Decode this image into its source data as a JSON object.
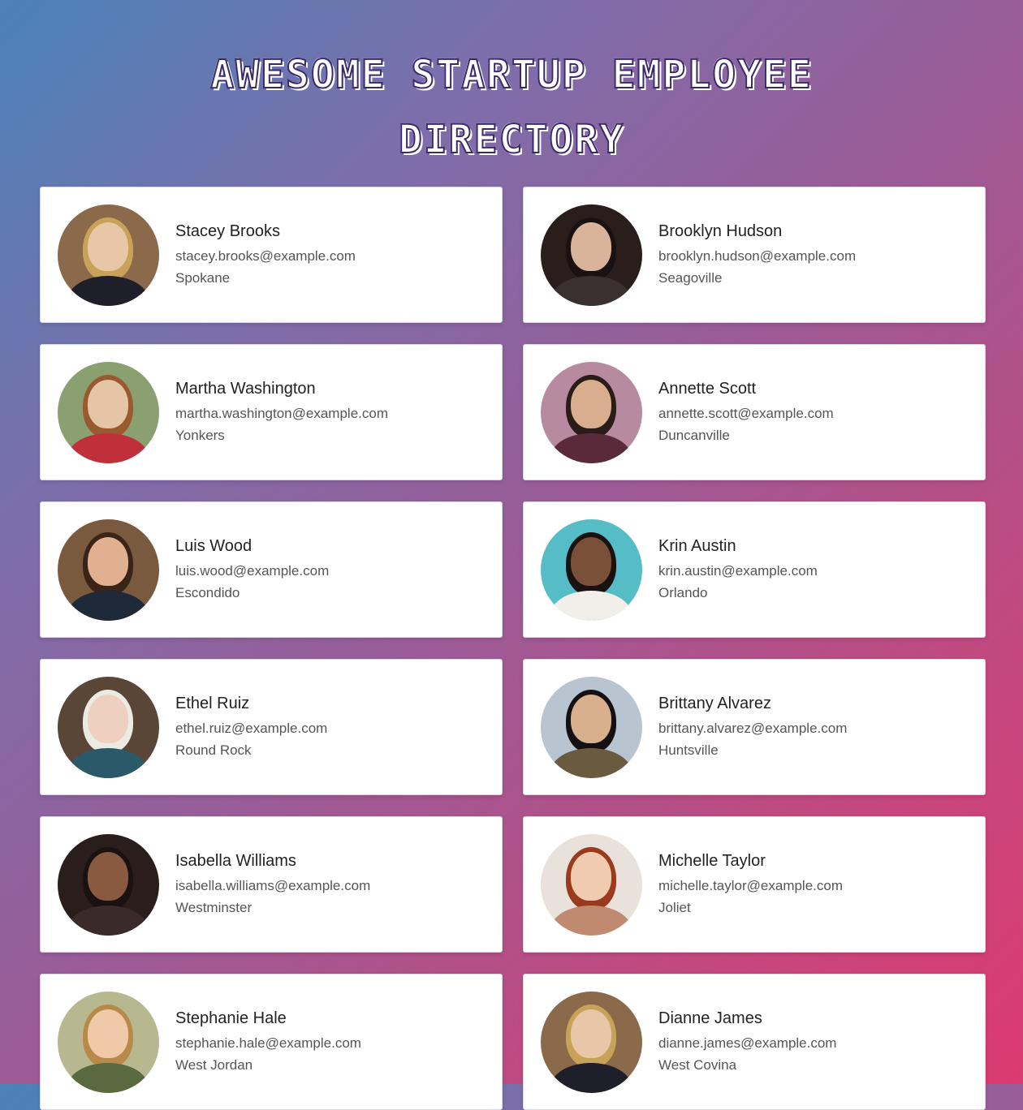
{
  "page": {
    "title": "Awesome Startup Employee Directory"
  },
  "employees": [
    {
      "name": "Stacey Brooks",
      "email": "stacey.brooks@example.com",
      "city": "Spokane",
      "avatar": {
        "bg": "#8a6a4a",
        "skin": "#e8c6a8",
        "hair": "#c9a25a",
        "clothes": "#1f1f2a"
      }
    },
    {
      "name": "Brooklyn Hudson",
      "email": "brooklyn.hudson@example.com",
      "city": "Seagoville",
      "avatar": {
        "bg": "#2a1e1c",
        "skin": "#d9b49a",
        "hair": "#1a1212",
        "clothes": "#3a3030"
      }
    },
    {
      "name": "Martha Washington",
      "email": "martha.washington@example.com",
      "city": "Yonkers",
      "avatar": {
        "bg": "#8aa070",
        "skin": "#e6c4a6",
        "hair": "#9a5a30",
        "clothes": "#c0303a"
      }
    },
    {
      "name": "Annette Scott",
      "email": "annette.scott@example.com",
      "city": "Duncanville",
      "avatar": {
        "bg": "#b88aa0",
        "skin": "#d8ae8e",
        "hair": "#2a1c18",
        "clothes": "#5a2a3a"
      }
    },
    {
      "name": "Luis Wood",
      "email": "luis.wood@example.com",
      "city": "Escondido",
      "avatar": {
        "bg": "#7a5a3e",
        "skin": "#e0b090",
        "hair": "#3a2418",
        "clothes": "#1e2a3a"
      }
    },
    {
      "name": "Krin Austin",
      "email": "krin.austin@example.com",
      "city": "Orlando",
      "avatar": {
        "bg": "#56bcc6",
        "skin": "#7a5038",
        "hair": "#1a1210",
        "clothes": "#f2eeea"
      }
    },
    {
      "name": "Ethel Ruiz",
      "email": "ethel.ruiz@example.com",
      "city": "Round Rock",
      "avatar": {
        "bg": "#5a4636",
        "skin": "#efd0c0",
        "hair": "#ecebe2",
        "clothes": "#2a5a6a"
      }
    },
    {
      "name": "Brittany Alvarez",
      "email": "brittany.alvarez@example.com",
      "city": "Huntsville",
      "avatar": {
        "bg": "#b8c4d0",
        "skin": "#d8b08e",
        "hair": "#141014",
        "clothes": "#6a5a40"
      }
    },
    {
      "name": "Isabella Williams",
      "email": "isabella.williams@example.com",
      "city": "Westminster",
      "avatar": {
        "bg": "#2a1e1c",
        "skin": "#8a5a40",
        "hair": "#1a1210",
        "clothes": "#3a2a2a"
      }
    },
    {
      "name": "Michelle Taylor",
      "email": "michelle.taylor@example.com",
      "city": "Joliet",
      "avatar": {
        "bg": "#e8e2da",
        "skin": "#f0cbb0",
        "hair": "#9a3a1e",
        "clothes": "#c08a70"
      }
    },
    {
      "name": "Stephanie Hale",
      "email": "stephanie.hale@example.com",
      "city": "West Jordan",
      "avatar": {
        "bg": "#b8b890",
        "skin": "#f0caa8",
        "hair": "#b88a4a",
        "clothes": "#5a6a40"
      }
    },
    {
      "name": "Dianne James",
      "email": "dianne.james@example.com",
      "city": "West Covina",
      "avatar": {
        "bg": "#8a6a4a",
        "skin": "#e8c6a8",
        "hair": "#c9a25a",
        "clothes": "#1f1f2a"
      }
    }
  ]
}
